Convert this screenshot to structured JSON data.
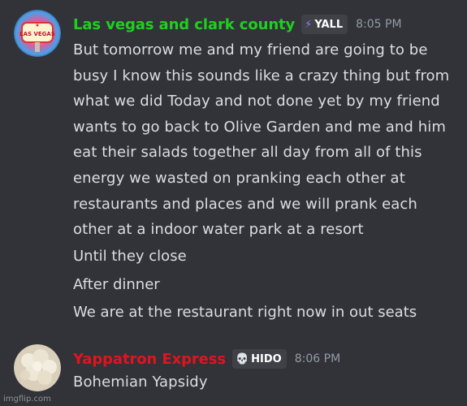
{
  "messages": [
    {
      "username": "Las vegas and clark county",
      "username_color": "#1fd01f",
      "tag_icon": "⚡",
      "tag_label": "YALL",
      "timestamp": "8:05 PM",
      "avatar_icon": "vegas-sign-avatar",
      "avatar_text": "LAS VEGAS",
      "lines": [
        "But tomorrow me and my friend are going to be busy I know this sounds like a crazy thing but from what we did Today and not done yet by my friend wants to go back to Olive Garden and me and him eat their salads together all day from all of this energy we wasted on pranking each other at restaurants and places and we will prank each other at a indoor water park at a resort",
        "Until they close",
        "After dinner",
        "We are at the restaurant right now in out seats"
      ]
    },
    {
      "username": "Yappatron Express",
      "username_color": "#e0141e",
      "tag_icon": "💀",
      "tag_label": "HIDO",
      "timestamp": "8:06 PM",
      "avatar_icon": "cauliflower-avatar",
      "lines": [
        "Bohemian Yapsidy"
      ]
    }
  ],
  "watermark": "imgflip.com"
}
